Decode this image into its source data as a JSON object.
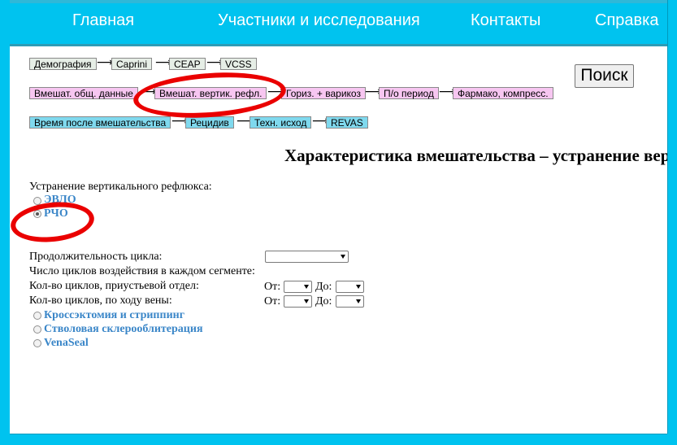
{
  "nav": {
    "home": "Главная",
    "members": "Участники и исследования",
    "contacts": "Контакты",
    "help": "Справка"
  },
  "breadcrumbs": {
    "row1": [
      "Демография",
      "Caprini",
      "CEAP",
      "VCSS"
    ],
    "row2": [
      "Вмешат. общ. данные",
      "Вмешат. вертик. рефл.",
      "Гориз. + варикоз",
      "П/о период",
      "Фармако, компресс."
    ],
    "row3": [
      "Время после вмешательства",
      "Рецидив",
      "Техн. исход",
      "REVAS"
    ],
    "arrow": "⟶"
  },
  "search": {
    "label": "Поиск"
  },
  "section": {
    "title": "Характеристика вмешательства – устранение вертикального рефлюкса"
  },
  "form": {
    "reflux_label": "Устранение вертикального рефлюкса:",
    "options_top": [
      "ЭВЛО",
      "РЧО"
    ],
    "selected": "РЧО",
    "cycle_duration_label": "Продолжительность цикла:",
    "cycles_per_segment_label": "Число циклов воздействия в каждом сегменте:",
    "cycles_ostial_label": "Кол-во циклов, приустьевой отдел:",
    "cycles_along_label": "Кол-во циклов, по ходу вены:",
    "from_label": "От:",
    "to_label": "До:",
    "options_bottom": [
      "Кроссэктомия и стриппинг",
      "Стволовая склерооблитерация",
      "VenaSeal"
    ]
  },
  "colors": {
    "navbar": "#00c3ef",
    "crumb_demo": "#e6eee6",
    "crumb_pink": "#f7c6f1",
    "crumb_blue": "#7fd9ee",
    "option_link": "#3a86c8",
    "annotation": "#ea0000"
  }
}
